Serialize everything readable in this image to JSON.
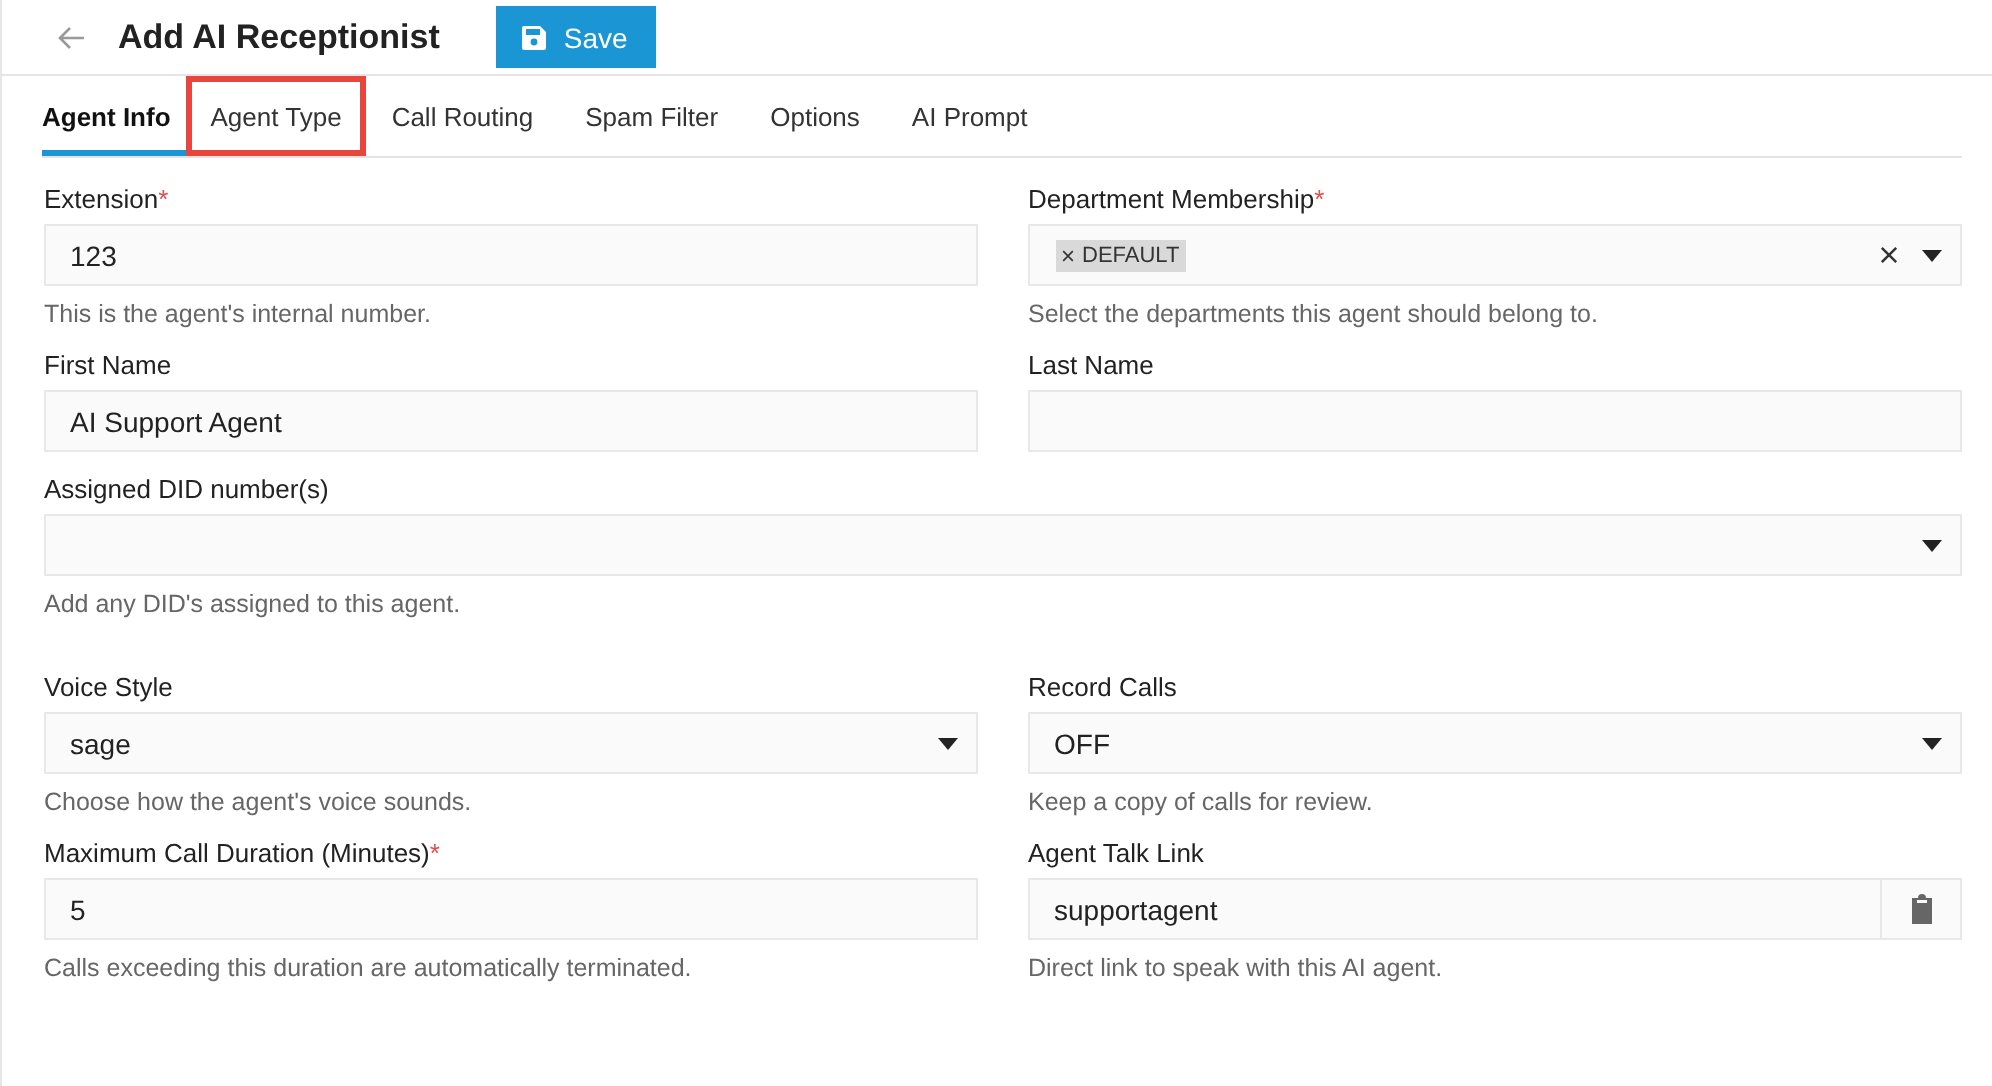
{
  "header": {
    "title": "Add AI Receptionist",
    "save_button": "Save"
  },
  "tabs": [
    {
      "label": "Agent Info",
      "selected": true,
      "highlighted": false
    },
    {
      "label": "Agent Type",
      "selected": false,
      "highlighted": true
    },
    {
      "label": "Call Routing",
      "selected": false,
      "highlighted": false
    },
    {
      "label": "Spam Filter",
      "selected": false,
      "highlighted": false
    },
    {
      "label": "Options",
      "selected": false,
      "highlighted": false
    },
    {
      "label": "AI Prompt",
      "selected": false,
      "highlighted": false
    }
  ],
  "sections": [
    {
      "rows": [
        {
          "fields": [
            {
              "kind": "text",
              "label": "Extension",
              "required_mark": "*",
              "value": "123",
              "help": "This is the agent's internal number."
            },
            {
              "kind": "tags",
              "label": "Department Membership",
              "required_mark": "*",
              "tags": [
                "DEFAULT"
              ],
              "help": "Select the departments this agent should belong to."
            }
          ]
        },
        {
          "fields": [
            {
              "kind": "text",
              "label": "First Name",
              "value": "AI Support Agent"
            },
            {
              "kind": "text",
              "label": "Last Name"
            }
          ]
        },
        {
          "fields": [
            {
              "kind": "select",
              "label": "Assigned DID number(s)",
              "help": "Add any DID's assigned to this agent."
            }
          ]
        }
      ]
    },
    {
      "rows": [
        {
          "fields": [
            {
              "kind": "select",
              "label": "Voice Style",
              "value": "sage",
              "help": "Choose how the agent's voice sounds."
            },
            {
              "kind": "select",
              "label": "Record Calls",
              "value": "OFF",
              "help": "Keep a copy of calls for review."
            }
          ]
        },
        {
          "fields": [
            {
              "kind": "text",
              "label": "Maximum Call Duration (Minutes)",
              "required_mark": "*",
              "value": "5",
              "help": "Calls exceeding this duration are automatically terminated."
            },
            {
              "kind": "link",
              "label": "Agent Talk Link",
              "value": "supportagent",
              "help": "Direct link to speak with this AI agent."
            }
          ]
        }
      ]
    }
  ]
}
